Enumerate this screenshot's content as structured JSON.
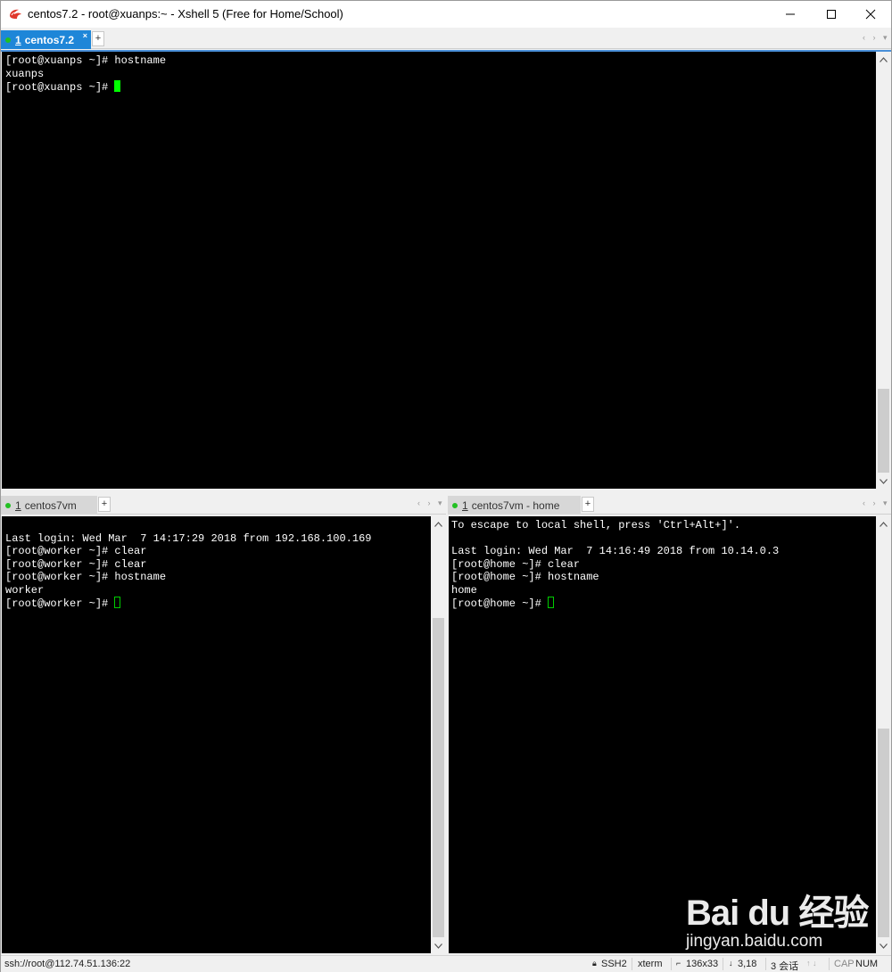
{
  "window": {
    "title": "centos7.2 - root@xuanps:~ - Xshell 5 (Free for Home/School)"
  },
  "top_pane": {
    "tab": {
      "number": "1",
      "label": "centos7.2",
      "close": "×"
    },
    "lines": [
      "[root@xuanps ~]# hostname",
      "xuanps",
      "[root@xuanps ~]# "
    ]
  },
  "left_pane": {
    "tab": {
      "number": "1",
      "label": "centos7vm",
      "close": ""
    },
    "lines": [
      "",
      "Last login: Wed Mar  7 14:17:29 2018 from 192.168.100.169",
      "[root@worker ~]# clear",
      "[root@worker ~]# clear",
      "[root@worker ~]# hostname",
      "worker",
      "[root@worker ~]# "
    ]
  },
  "right_pane": {
    "tab": {
      "number": "1",
      "label": "centos7vm - home",
      "close": ""
    },
    "lines": [
      "To escape to local shell, press 'Ctrl+Alt+]'.",
      "",
      "Last login: Wed Mar  7 14:16:49 2018 from 10.14.0.3",
      "[root@home ~]# clear",
      "[root@home ~]# hostname",
      "home",
      "[root@home ~]# "
    ]
  },
  "statusbar": {
    "connection": "ssh://root@112.74.51.136:22",
    "protocol": "SSH2",
    "terminal_type": "xterm",
    "size": "136x33",
    "cursor_pos": "3,18",
    "sessions": "3 会话",
    "cap": "CAP",
    "num": "NUM"
  },
  "watermark": {
    "brand": "Bai du 经验",
    "url": "jingyan.baidu.com"
  },
  "colors": {
    "accent_tab": "#1e86d8",
    "cursor": "#00ff00",
    "terminal_bg": "#000000"
  },
  "icons": [
    "xshell-app-icon",
    "minimize-icon",
    "maximize-icon",
    "close-icon",
    "add-tab-icon",
    "scroll-up-icon",
    "scroll-down-icon",
    "lock-icon"
  ]
}
